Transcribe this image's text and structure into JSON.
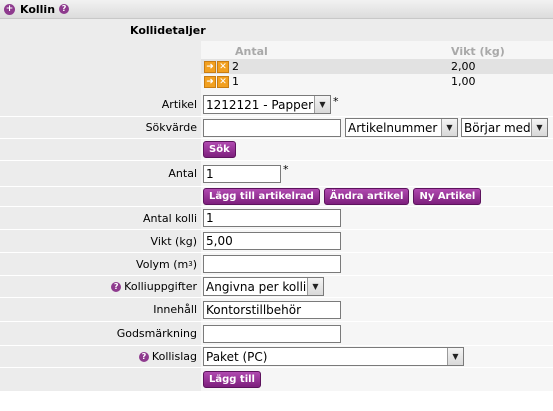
{
  "header": {
    "title": "Kollin",
    "help": "?"
  },
  "section": {
    "title": "Kollidetaljer"
  },
  "items": {
    "columns": {
      "antal": "Antal",
      "vikt": "Vikt (kg)"
    },
    "rows": [
      {
        "antal": "2",
        "vikt": "2,00"
      },
      {
        "antal": "1",
        "vikt": "1,00"
      }
    ]
  },
  "fields": {
    "artikel": {
      "label": "Artikel",
      "value": "1212121 - Papper"
    },
    "sokvarde": {
      "label": "Sökvärde",
      "value": "",
      "type": "Artikelnummer",
      "match": "Börjar med"
    },
    "sok_button": "Sök",
    "antal": {
      "label": "Antal",
      "value": "1"
    },
    "buttons": {
      "add_row": "Lägg till artikelrad",
      "edit": "Ändra artikel",
      "new": "Ny Artikel"
    },
    "antal_kolli": {
      "label": "Antal kolli",
      "value": "1"
    },
    "vikt": {
      "label": "Vikt (kg)",
      "value": "5,00"
    },
    "volym": {
      "label": "Volym (m",
      "label_sup": "3",
      "label_end": ")",
      "value": ""
    },
    "kolliuppgifter": {
      "label": "Kolliuppgifter",
      "value": "Angivna per kolli"
    },
    "innehall": {
      "label": "Innehåll",
      "value": "Kontorstillbehör"
    },
    "godsmarkning": {
      "label": "Godsmärkning",
      "value": ""
    },
    "kollislag": {
      "label": "Kollislag",
      "value": "Paket (PC)"
    },
    "add_button": "Lägg till"
  },
  "symbols": {
    "required": "*",
    "plus": "+",
    "help": "?"
  },
  "colors": {
    "accent": "#8e3a8e",
    "action_icon": "#f2a020",
    "label_bg": "#ececec",
    "value_bg": "#f6f6f6"
  }
}
